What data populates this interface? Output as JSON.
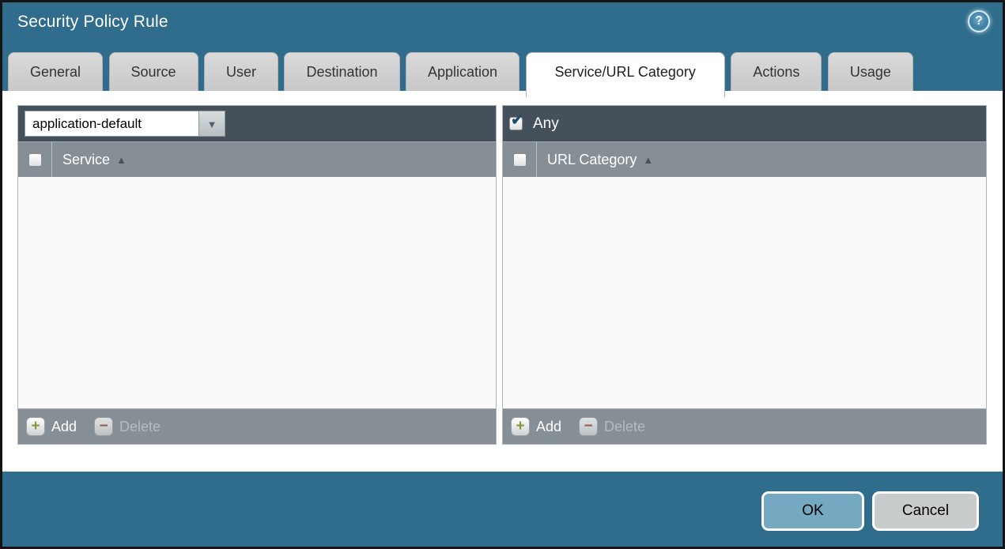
{
  "window": {
    "title": "Security Policy Rule"
  },
  "icons": {
    "help": "?",
    "dropdown_arrow": "▼",
    "sort_asc": "▲",
    "check": "✔",
    "add": "+",
    "delete": "−"
  },
  "tabs": [
    {
      "label": "General",
      "active": false
    },
    {
      "label": "Source",
      "active": false
    },
    {
      "label": "User",
      "active": false
    },
    {
      "label": "Destination",
      "active": false
    },
    {
      "label": "Application",
      "active": false
    },
    {
      "label": "Service/URL Category",
      "active": true
    },
    {
      "label": "Actions",
      "active": false
    },
    {
      "label": "Usage",
      "active": false
    }
  ],
  "service_panel": {
    "select_value": "application-default",
    "column_header": "Service",
    "header_checkbox_checked": false,
    "rows": [],
    "add_label": "Add",
    "delete_label": "Delete",
    "delete_enabled": false
  },
  "url_category_panel": {
    "any_label": "Any",
    "any_checked": true,
    "column_header": "URL Category",
    "header_checkbox_checked": false,
    "rows": [],
    "add_label": "Add",
    "delete_label": "Delete",
    "delete_enabled": false
  },
  "dialog_buttons": {
    "ok_label": "OK",
    "cancel_label": "Cancel"
  },
  "colors": {
    "background_teal": "#306d8c",
    "panel_header_dark": "#44505a",
    "panel_header_gray": "#878f96",
    "add_green": "#7c9c2f",
    "delete_red": "#9c4a40",
    "ok_blue": "#74a9c1"
  }
}
